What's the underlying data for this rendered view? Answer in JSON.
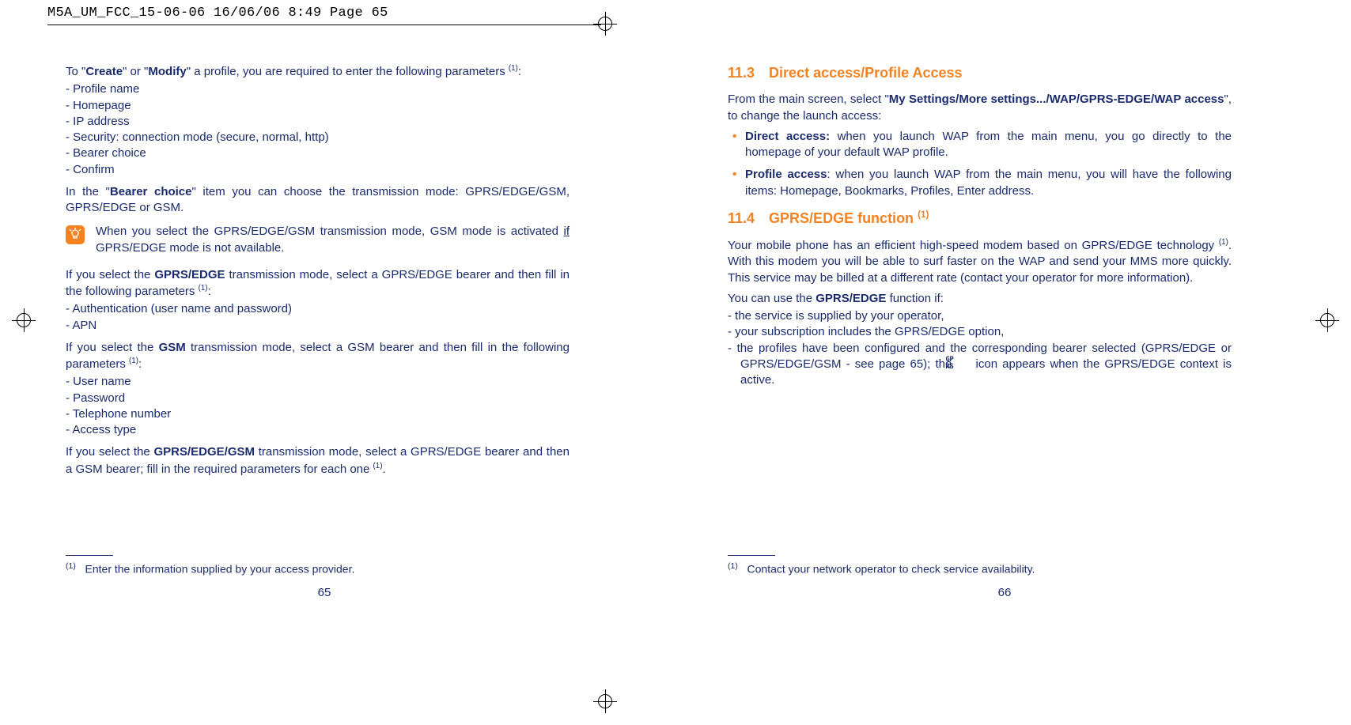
{
  "slug": "M5A_UM_FCC_15-06-06  16/06/06  8:49  Page 65",
  "left": {
    "p1_pre": "To \"",
    "p1_b1": "Create",
    "p1_mid": "\" or \"",
    "p1_b2": "Modify",
    "p1_post": "\" a profile, you are required to enter the following parameters ",
    "p1_sup": "(1)",
    "p1_end": ":",
    "list1": {
      "i1": "Profile name",
      "i2": "Homepage",
      "i3": "IP address",
      "i4": "Security: connection mode (secure, normal, http)",
      "i5": "Bearer choice",
      "i6": "Confirm"
    },
    "p2_pre": "In the \"",
    "p2_b": "Bearer choice",
    "p2_post": "\" item you can choose the transmission mode: GPRS/EDGE/GSM, GPRS/EDGE or GSM.",
    "note_pre": "When you select the GPRS/EDGE/GSM transmission mode, GSM mode is activated ",
    "note_if": "if",
    "note_post": " GPRS/EDGE mode is not available.",
    "p3_pre": "If you select the ",
    "p3_b": "GPRS/EDGE",
    "p3_post": " transmission mode, select a GPRS/EDGE bearer and then fill in the following parameters ",
    "p3_sup": "(1)",
    "p3_end": ":",
    "list2": {
      "i1": "Authentication (user name and password)",
      "i2": "APN"
    },
    "p4_pre": "If you select the ",
    "p4_b": "GSM",
    "p4_post": " transmission mode, select a GSM bearer and then fill in the following parameters ",
    "p4_sup": "(1)",
    "p4_end": ":",
    "list3": {
      "i1": "User name",
      "i2": "Password",
      "i3": "Telephone number",
      "i4": "Access type"
    },
    "p5_pre": "If you select the ",
    "p5_b": "GPRS/EDGE/GSM",
    "p5_post": " transmission mode, select a GPRS/EDGE bearer and then a GSM bearer; fill in the required parameters for each one ",
    "p5_sup": "(1)",
    "p5_end": ".",
    "foot_sup": "(1)",
    "foot": "Enter the information supplied by your access provider.",
    "pagenum": "65"
  },
  "right": {
    "h1_num": "11.3",
    "h1_title": "Direct access/Profile Access",
    "p1_pre": "From the main screen, select \"",
    "p1_b": "My Settings/More settings.../WAP/GPRS-EDGE/WAP access",
    "p1_post": "\", to change the launch access:",
    "bul1_b": "Direct access:",
    "bul1_t": " when you launch WAP from the main menu, you go directly to the homepage of your default WAP profile.",
    "bul2_b": "Profile access",
    "bul2_t": ": when you launch WAP from the main menu, you will have the following items: Homepage, Bookmarks, Profiles, Enter address.",
    "h2_num": "11.4",
    "h2_title": "GPRS/EDGE function ",
    "h2_sup": "(1)",
    "p2_pre": "Your mobile phone has an efficient high-speed modem based on GPRS/EDGE technology ",
    "p2_sup": "(1)",
    "p2_post": ". With this modem you will be able to surf faster on the WAP and send your MMS more quickly. This service may be billed at a different rate (contact your operator for more information).",
    "p3_pre": "You can use the ",
    "p3_b": "GPRS/EDGE",
    "p3_post": " function if:",
    "list1": {
      "i1": "the service is supplied by your operator,",
      "i2": "your subscription includes the GPRS/EDGE option,",
      "i3_pre": "the profiles have been configured and the corresponding bearer selected (GPRS/EDGE or GPRS/EDGE/GSM - see page 65); the ",
      "i3_post": " icon appears when the GPRS/EDGE context is active."
    },
    "foot_sup": "(1)",
    "foot": "Contact your network operator to check service availability.",
    "pagenum": "66"
  }
}
